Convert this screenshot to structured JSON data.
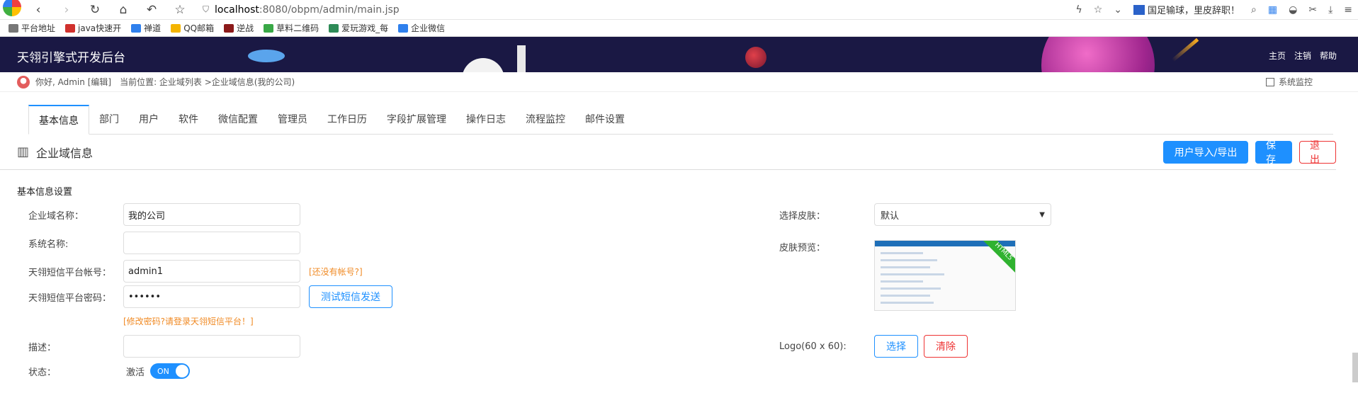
{
  "browser": {
    "url_host": "localhost",
    "url_path": ":8080/obpm/admin/main.jsp",
    "news_text": "国足输球，里皮辞职！"
  },
  "bookmarks": [
    {
      "label": "平台地址",
      "color": "#777777"
    },
    {
      "label": "java快速开",
      "color": "#d0312d"
    },
    {
      "label": "禅道",
      "color": "#2f80ed"
    },
    {
      "label": "QQ邮箱",
      "color": "#f4b400"
    },
    {
      "label": "逆战",
      "color": "#8b1a1a"
    },
    {
      "label": "草料二维码",
      "color": "#39a846"
    },
    {
      "label": "爱玩游戏_每",
      "color": "#2e8b57"
    },
    {
      "label": "企业微信",
      "color": "#2f80ed"
    }
  ],
  "header": {
    "title": "天翎引擎式开发后台",
    "links": [
      "主页",
      "注销",
      "帮助"
    ]
  },
  "crumb": {
    "greeting": "你好, Admin [编辑]",
    "location": "当前位置: 企业域列表 >企业域信息(我的公司)",
    "sysmon": "系统监控"
  },
  "tabs": [
    "基本信息",
    "部门",
    "用户",
    "软件",
    "微信配置",
    "管理员",
    "工作日历",
    "字段扩展管理",
    "操作日志",
    "流程监控",
    "邮件设置"
  ],
  "section": {
    "title": "企业域信息",
    "import_export": "用户导入/导出",
    "save": "保存",
    "exit": "退出"
  },
  "form": {
    "heading": "基本信息设置",
    "domain_name_label": "企业域名称：",
    "domain_name_value": "我的公司",
    "system_name_label": "系统名称:",
    "system_name_value": "",
    "sms_account_label": "天翎短信平台帐号：",
    "sms_account_value": "admin1",
    "no_account_hint": "[还没有帐号?]",
    "sms_password_label": "天翎短信平台密码：",
    "sms_password_value": "••••••",
    "test_sms_button": "测试短信发送",
    "password_hint": "[修改密码?请登录天翎短信平台！]",
    "desc_label": "描述：",
    "desc_value": "",
    "status_label": "状态：",
    "status_value": "激活",
    "toggle_text": "ON",
    "skin_label": "选择皮肤：",
    "skin_value": "默认",
    "skin_preview_label": "皮肤预览：",
    "preview_badge": "HTML5",
    "logo_label": "Logo(60 x 60):",
    "logo_select": "选择",
    "logo_clear": "清除"
  }
}
